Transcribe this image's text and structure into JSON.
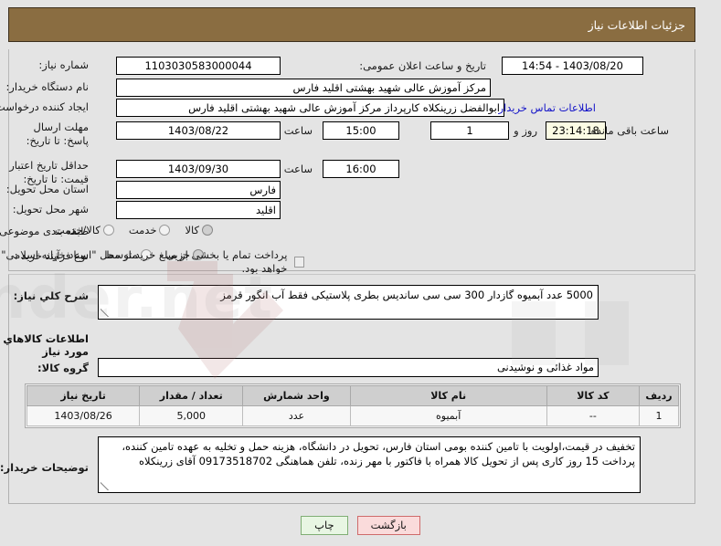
{
  "header": {
    "title": "جزئیات اطلاعات نیاز"
  },
  "colors": {
    "header_bg": "#8a6d41",
    "page_bg": "#e4e4e4",
    "link": "#1414c8",
    "countdown_bg": "#fbfbe4",
    "btn_back_bg": "#fadbdb",
    "btn_print_bg": "#e8f6e3"
  },
  "form": {
    "need_number_label": "شماره نیاز:",
    "need_number_value": "1103030583000044",
    "public_announce_label": "تاریخ و ساعت اعلان عمومی:",
    "public_announce_value": "1403/08/20 - 14:54",
    "buyer_org_label": "نام دستگاه خریدار:",
    "buyer_org_value": "مرکز آموزش عالی شهید بهشتی اقلید فارس",
    "creator_label": "ایجاد کننده درخواست:",
    "creator_value": "ابوالفضل زرینکلاه کارپرداز مرکز آموزش عالی شهید بهشتی اقلید فارس",
    "contact_link": "اطلاعات تماس خریدار",
    "deadline_label": "مهلت ارسال پاسخ: تا تاریخ:",
    "deadline_date": "1403/08/22",
    "deadline_time_label": "ساعت",
    "deadline_time": "15:00",
    "remaining_days": "1",
    "remaining_days_suffix": "روز و",
    "remaining_clock": "23:14:18",
    "remaining_suffix": "ساعت باقی مانده",
    "price_validity_label": "حداقل تاریخ اعتبار قیمت: تا تاریخ:",
    "price_validity_date": "1403/09/30",
    "price_validity_time_label": "ساعت",
    "price_validity_time": "16:00",
    "province_label": "استان محل تحویل:",
    "province_value": "فارس",
    "city_label": "شهر محل تحویل:",
    "city_value": "اقلید",
    "category_label": "طبقه بندی موضوعی:",
    "category_options": [
      "کالا",
      "خدمت",
      "کالا/خدمت"
    ],
    "category_selected": "کالا",
    "process_label": "نوع فرآیند خرید :",
    "process_options": [
      "جزیی",
      "متوسط"
    ],
    "process_selected": "جزیی",
    "treasury_checkbox_label": "پرداخت تمام یا بخشی از مبلغ خرید،از محل \"اسناد خزانه اسلامی\" خواهد بود.",
    "treasury_checked": false
  },
  "summary": {
    "label": "شرح کلي نیاز:",
    "value": "5000 عدد آبمیوه گازدار 300 سی سی ساندیس بطری پلاستیکی فقط آب انگور قرمز"
  },
  "goods_section": {
    "title": "اطلاعات کالاهاي مورد نیاز",
    "group_label": "گروه کالا:",
    "group_value": "مواد غذائی و نوشیدنی"
  },
  "table": {
    "columns": [
      "ردیف",
      "کد کالا",
      "نام کالا",
      "واحد شمارش",
      "تعداد / مقدار",
      "تاریخ نیاز"
    ],
    "rows": [
      {
        "row_no": "1",
        "code": "--",
        "name": "آبمیوه",
        "unit": "عدد",
        "qty": "5,000",
        "need_date": "1403/08/26"
      }
    ]
  },
  "notes": {
    "label": "توضیحات خریدار:",
    "line1": "تخفیف در قیمت،اولویت با تامین کننده بومی استان فارس، تحویل در دانشگاه، هزینه حمل و تخلیه به عهده تامین کننده،",
    "line2": "پرداخت 15 روز کاری پس از تحویل کالا همراه با فاکتور با مهر زنده، تلفن هماهنگی 09173518702 آقای زرینکلاه"
  },
  "buttons": {
    "back": "بازگشت",
    "print": "چاپ"
  }
}
